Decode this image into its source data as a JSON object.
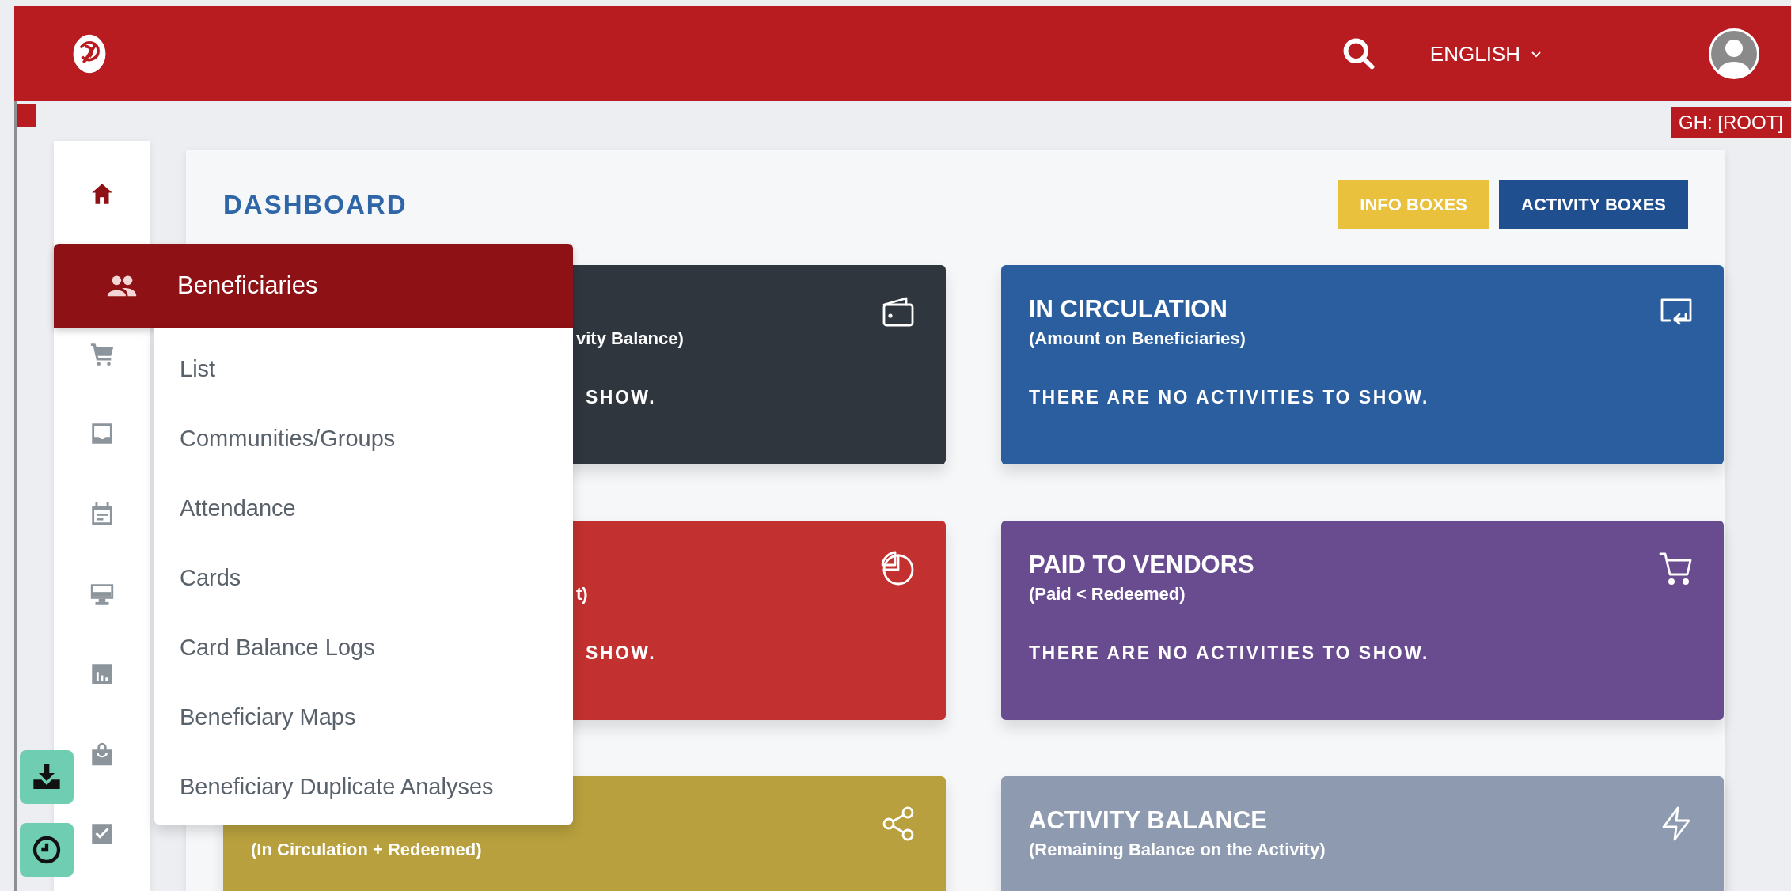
{
  "header": {
    "language": "ENGLISH",
    "badge": "GH: [ROOT]"
  },
  "sidebar": {
    "items": [
      {
        "selected": true
      },
      {
        "label": "Beneficiaries",
        "selected": false,
        "expanded": true,
        "children": [
          {
            "label": "List"
          },
          {
            "label": "Communities/Groups"
          },
          {
            "label": "Attendance"
          },
          {
            "label": "Cards"
          },
          {
            "label": "Card Balance Logs"
          },
          {
            "label": "Beneficiary Maps"
          },
          {
            "label": "Beneficiary Duplicate Analyses"
          }
        ]
      },
      {
        "selected": false
      },
      {
        "selected": false
      },
      {
        "selected": false
      },
      {
        "selected": false
      },
      {
        "selected": false
      },
      {
        "selected": false
      },
      {
        "selected": false
      }
    ]
  },
  "page": {
    "title": "DASHBOARD",
    "buttons": [
      {
        "label": "INFO BOXES",
        "color": "#e9c13d"
      },
      {
        "label": "ACTIVITY BOXES",
        "color": "#1f4f8f"
      }
    ]
  },
  "cards": [
    {
      "color": "#30363e",
      "subtitle": "vity Balance)",
      "message": "SHOW."
    },
    {
      "color": "#2b5e9f",
      "title": "IN CIRCULATION",
      "subtitle": "(Amount on Beneficiaries)",
      "message": "THERE ARE NO ACTIVITIES TO SHOW."
    },
    {
      "color": "#c2302f",
      "subtitle": "t)",
      "message": "SHOW."
    },
    {
      "color": "#694b8f",
      "title": "PAID TO VENDORS",
      "subtitle": "(Paid < Redeemed)",
      "message": "THERE ARE NO ACTIVITIES TO SHOW."
    },
    {
      "color": "#b7a03d",
      "subtitle": "(In Circulation + Redeemed)"
    },
    {
      "color": "#8e9ab0",
      "title": "ACTIVITY BALANCE",
      "subtitle": "(Remaining Balance on the Activity)"
    }
  ]
}
